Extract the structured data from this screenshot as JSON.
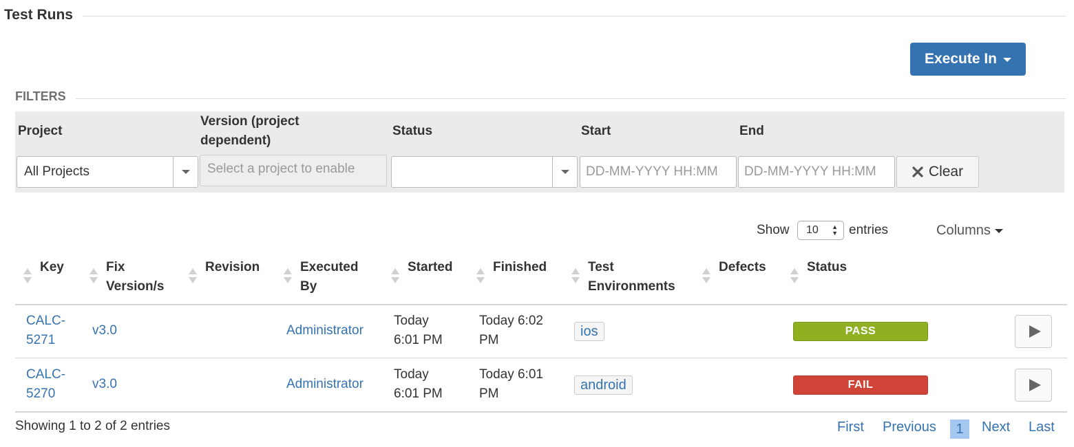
{
  "section": {
    "title": "Test Runs"
  },
  "execute_button": {
    "label": "Execute In"
  },
  "filters": {
    "title": "FILTERS",
    "project": {
      "label": "Project",
      "value": "All Projects"
    },
    "version": {
      "label_line1": "Version (project",
      "label_line2": "dependent)",
      "placeholder": "Select a project to enable"
    },
    "status": {
      "label": "Status",
      "value": ""
    },
    "start": {
      "label": "Start",
      "placeholder": "DD-MM-YYYY HH:MM"
    },
    "end": {
      "label": "End",
      "placeholder": "DD-MM-YYYY HH:MM"
    },
    "clear_label": "Clear"
  },
  "table_controls": {
    "show_label": "Show",
    "entries_value": "10",
    "entries_label": "entries",
    "columns_label": "Columns"
  },
  "columns": {
    "key": "Key",
    "fix_version_1": "Fix",
    "fix_version_2": "Version/s",
    "revision": "Revision",
    "executed_by_1": "Executed",
    "executed_by_2": "By",
    "started": "Started",
    "finished": "Finished",
    "test_env_1": "Test",
    "test_env_2": "Environments",
    "defects": "Defects",
    "status": "Status"
  },
  "rows": [
    {
      "key_1": "CALC-",
      "key_2": "5271",
      "fix_version": "v3.0",
      "revision": "",
      "executed_by": "Administrator",
      "started_1": "Today",
      "started_2": "6:01 PM",
      "finished_1": "Today 6:02",
      "finished_2": "PM",
      "environment": "ios",
      "defects": "",
      "status": "PASS",
      "status_color": "#8eb021"
    },
    {
      "key_1": "CALC-",
      "key_2": "5270",
      "fix_version": "v3.0",
      "revision": "",
      "executed_by": "Administrator",
      "started_1": "Today",
      "started_2": "6:01 PM",
      "finished_1": "Today 6:01",
      "finished_2": "PM",
      "environment": "android",
      "defects": "",
      "status": "FAIL",
      "status_color": "#d04437"
    }
  ],
  "footer": {
    "info": "Showing 1 to 2 of 2 entries",
    "first": "First",
    "previous": "Previous",
    "current_page": "1",
    "next": "Next",
    "last": "Last"
  },
  "colors": {
    "primary": "#3572b0",
    "pass": "#8eb021",
    "fail": "#d04437"
  }
}
